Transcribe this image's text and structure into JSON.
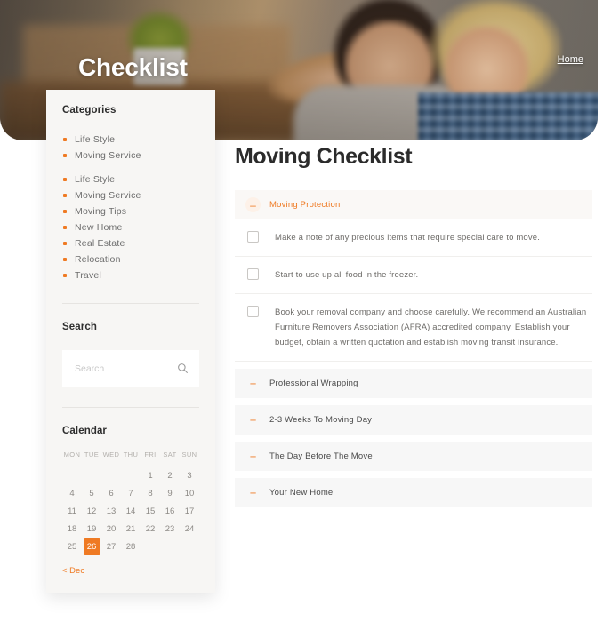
{
  "hero": {
    "title": "Checklist",
    "nav_home": "Home"
  },
  "sidebar": {
    "categories_title": "Categories",
    "categories": [
      {
        "label": "Life Style",
        "gap": false
      },
      {
        "label": "Moving Service",
        "gap": false
      },
      {
        "label": "Life Style",
        "gap": true
      },
      {
        "label": "Moving Service",
        "gap": false
      },
      {
        "label": "Moving Tips",
        "gap": false
      },
      {
        "label": "New Home",
        "gap": false
      },
      {
        "label": "Real Estate",
        "gap": false
      },
      {
        "label": "Relocation",
        "gap": false
      },
      {
        "label": "Travel",
        "gap": false
      }
    ],
    "search_title": "Search",
    "search_placeholder": "Search",
    "search_value": "",
    "search_icon": "search-icon",
    "calendar_title": "Calendar",
    "calendar": {
      "day_headers": [
        "MON",
        "TUE",
        "WED",
        "THU",
        "FRI",
        "SAT",
        "SUN"
      ],
      "weeks": [
        [
          "",
          "",
          "",
          "",
          "1",
          "2",
          "3"
        ],
        [
          "4",
          "5",
          "6",
          "7",
          "8",
          "9",
          "10"
        ],
        [
          "11",
          "12",
          "13",
          "14",
          "15",
          "16",
          "17"
        ],
        [
          "18",
          "19",
          "20",
          "21",
          "22",
          "23",
          "24"
        ],
        [
          "25",
          "26",
          "27",
          "28",
          "",
          "",
          ""
        ]
      ],
      "selected_day": "26",
      "prev_link": "< Dec"
    }
  },
  "main": {
    "title": "Moving Checklist",
    "accordion": [
      {
        "label": "Moving Protection",
        "state": "expanded",
        "icon": "minus-icon",
        "tasks": [
          {
            "text": "Make a note of any precious items that require special care to move.",
            "checked": false
          },
          {
            "text": "Start to use up all food in the freezer.",
            "checked": false
          },
          {
            "text": "Book your removal company and choose carefully. We recommend an Australian Furniture Removers Association (AFRA) accredited company. Establish your budget, obtain a written quotation and establish moving transit insurance.",
            "checked": false
          }
        ]
      },
      {
        "label": "Professional Wrapping",
        "state": "collapsed",
        "icon": "plus-icon",
        "tasks": []
      },
      {
        "label": "2-3 Weeks To Moving Day",
        "state": "collapsed",
        "icon": "plus-icon",
        "tasks": []
      },
      {
        "label": "The Day Before The Move",
        "state": "collapsed",
        "icon": "plus-icon",
        "tasks": []
      },
      {
        "label": "Your New Home",
        "state": "collapsed",
        "icon": "plus-icon",
        "tasks": []
      }
    ]
  },
  "colors": {
    "accent": "#ef7a23",
    "text_dark": "#2b2b2b",
    "text_muted": "#6e6c69",
    "panel_bg": "#f7f6f4",
    "row_bg": "#f7f7f7"
  }
}
